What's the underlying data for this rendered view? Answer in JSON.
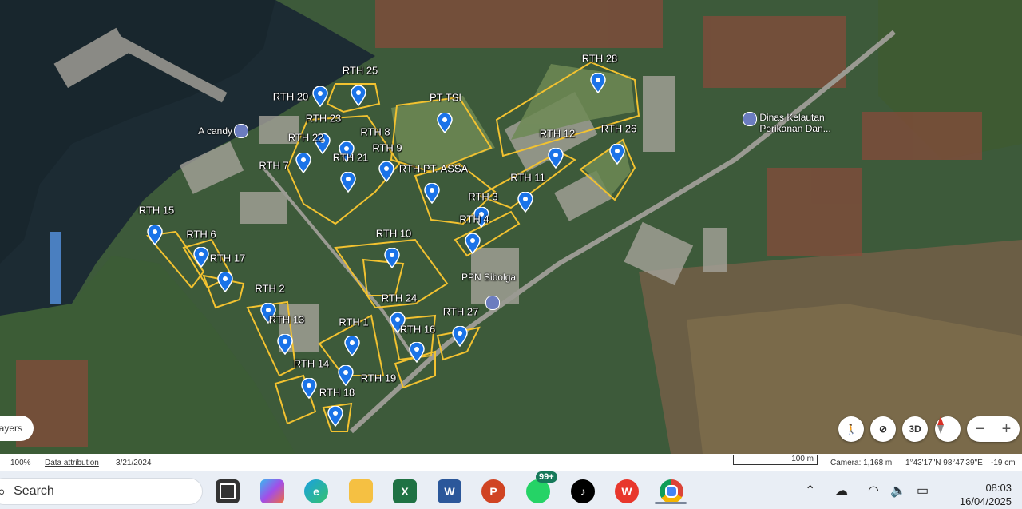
{
  "map": {
    "area_labels": [
      {
        "text": "RTH 25"
      },
      {
        "text": "RTH 20"
      },
      {
        "text": "RTH 23"
      },
      {
        "text": "RTH 8"
      },
      {
        "text": "PT TSI"
      },
      {
        "text": "RTH 28"
      },
      {
        "text": "RTH 12"
      },
      {
        "text": "RTH 26"
      },
      {
        "text": "RTH 22"
      },
      {
        "text": "RTH 21"
      },
      {
        "text": "RTH 9"
      },
      {
        "text": "RTH 7"
      },
      {
        "text": "RTH PT. ASSA"
      },
      {
        "text": "RTH 11"
      },
      {
        "text": "RTH 3"
      },
      {
        "text": "RTH 15"
      },
      {
        "text": "RTH 4"
      },
      {
        "text": "RTH 6"
      },
      {
        "text": "RTH 10"
      },
      {
        "text": "RTH 17"
      },
      {
        "text": "RTH 2"
      },
      {
        "text": "RTH 24"
      },
      {
        "text": "RTH 27"
      },
      {
        "text": "RTH 13"
      },
      {
        "text": "RTH 1"
      },
      {
        "text": "RTH 16"
      },
      {
        "text": "RTH 14"
      },
      {
        "text": "RTH 19"
      },
      {
        "text": "RTH 18"
      }
    ],
    "pois": [
      {
        "text": "A candy",
        "icon": "museum-icon"
      },
      {
        "text": "Dinas Kelautan\nPerikanan Dan...",
        "icon": "museum-icon"
      },
      {
        "text": "PPN Sibolga",
        "icon": "museum-icon"
      }
    ],
    "pin_count": 29,
    "accent_outline": "#f2c230",
    "pin_color": "#1a73e8"
  },
  "controls": {
    "layers_label": "ayers",
    "threed_label": "3D",
    "zoom_out": "−",
    "zoom_in": "+"
  },
  "footer": {
    "zoom": "100%",
    "attribution": "Data attribution",
    "date": "3/21/2024",
    "scale": "100 m",
    "camera": "Camera: 1,168 m",
    "coords": "1°43'17\"N 98°47'39\"E",
    "elevation": "-19 cm"
  },
  "taskbar": {
    "search_label": "Search",
    "apps": [
      "task-view",
      "copilot",
      "edge",
      "file-explorer",
      "excel",
      "word",
      "powerpoint",
      "whatsapp",
      "tiktok",
      "wps",
      "chrome"
    ],
    "whatsapp_badge": "99+",
    "time": "08:03",
    "date": "16/04/2025"
  }
}
